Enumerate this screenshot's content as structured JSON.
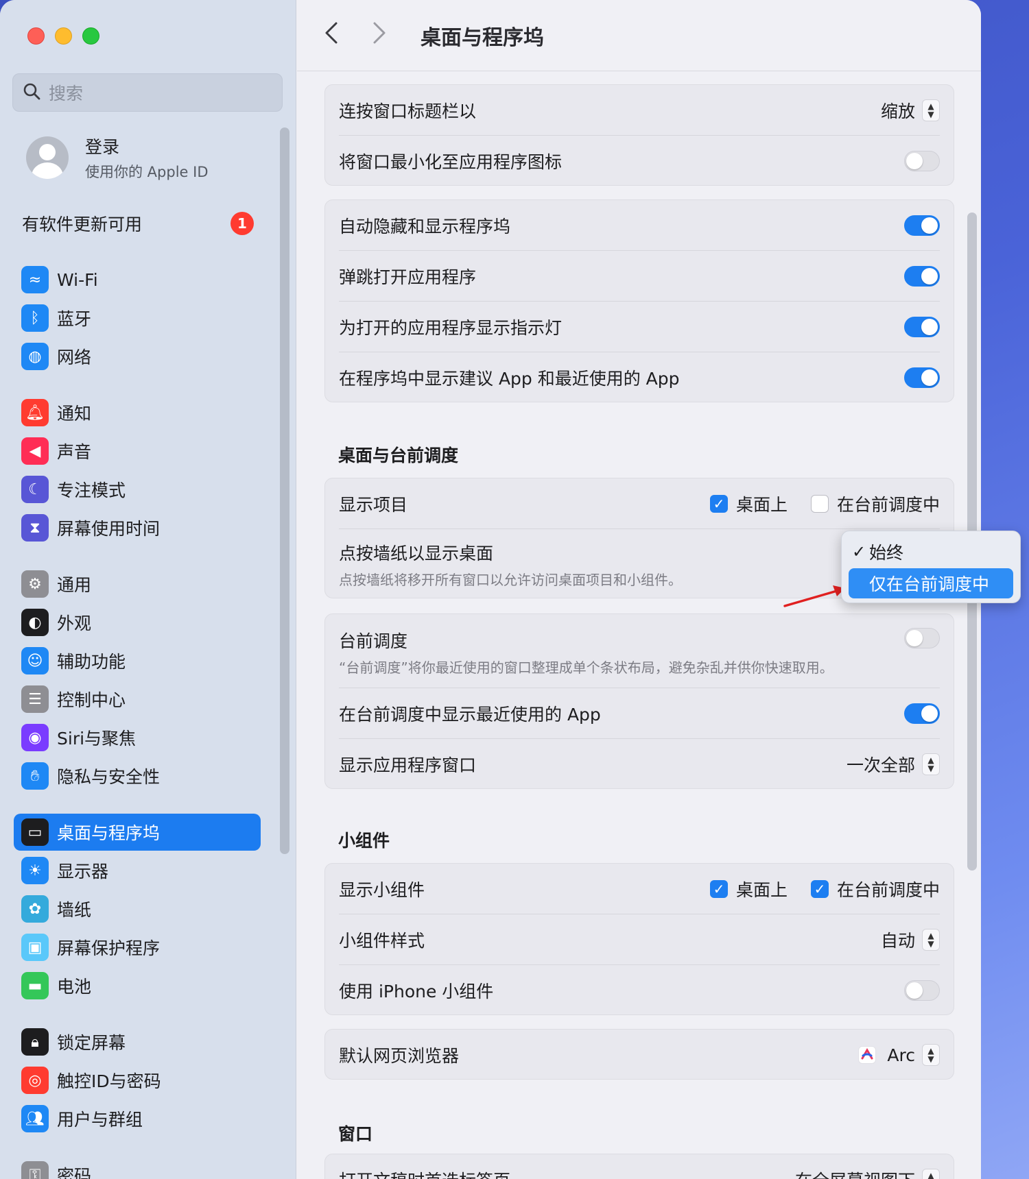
{
  "window": {
    "title": "桌面与程序坞"
  },
  "search": {
    "placeholder": "搜索"
  },
  "account": {
    "title": "登录",
    "subtitle": "使用你的 Apple ID"
  },
  "update": {
    "label": "有软件更新可用",
    "count": "1"
  },
  "sidebar": {
    "items": [
      {
        "label": "Wi-Fi",
        "icon": "wifi-icon",
        "color": "#1e88f5"
      },
      {
        "label": "蓝牙",
        "icon": "bluetooth-icon",
        "color": "#1e88f5"
      },
      {
        "label": "网络",
        "icon": "globe-icon",
        "color": "#1e88f5"
      },
      {
        "label": "通知",
        "icon": "bell-icon",
        "color": "#ff3b30"
      },
      {
        "label": "声音",
        "icon": "speaker-icon",
        "color": "#ff2d55"
      },
      {
        "label": "专注模式",
        "icon": "moon-icon",
        "color": "#5856d6"
      },
      {
        "label": "屏幕使用时间",
        "icon": "hourglass-icon",
        "color": "#5856d6"
      },
      {
        "label": "通用",
        "icon": "gear-icon",
        "color": "#8e8e93"
      },
      {
        "label": "外观",
        "icon": "appearance-icon",
        "color": "#1d1d1f"
      },
      {
        "label": "辅助功能",
        "icon": "accessibility-icon",
        "color": "#1e88f5"
      },
      {
        "label": "控制中心",
        "icon": "control-center-icon",
        "color": "#8e8e93"
      },
      {
        "label": "Siri与聚焦",
        "icon": "siri-icon",
        "color": "#7a3cff"
      },
      {
        "label": "隐私与安全性",
        "icon": "hand-icon",
        "color": "#1e88f5"
      },
      {
        "label": "桌面与程序坞",
        "icon": "dock-icon",
        "color": "#1d1d1f"
      },
      {
        "label": "显示器",
        "icon": "sun-icon",
        "color": "#1e88f5"
      },
      {
        "label": "墙纸",
        "icon": "flower-icon",
        "color": "#34aadc"
      },
      {
        "label": "屏幕保护程序",
        "icon": "screensaver-icon",
        "color": "#5ac8fa"
      },
      {
        "label": "电池",
        "icon": "battery-icon",
        "color": "#34c759"
      },
      {
        "label": "锁定屏幕",
        "icon": "lock-icon",
        "color": "#1d1d1f"
      },
      {
        "label": "触控ID与密码",
        "icon": "fingerprint-icon",
        "color": "#ff3b30"
      },
      {
        "label": "用户与群组",
        "icon": "users-icon",
        "color": "#1e88f5"
      },
      {
        "label": "密码",
        "icon": "key-icon",
        "color": "#8e8e93"
      }
    ]
  },
  "settings": {
    "double_click": {
      "label": "连按窗口标题栏以",
      "value": "缩放"
    },
    "minimize_to_icon": {
      "label": "将窗口最小化至应用程序图标"
    },
    "autohide": {
      "label": "自动隐藏和显示程序坞"
    },
    "bounce": {
      "label": "弹跳打开应用程序"
    },
    "indicators": {
      "label": "为打开的应用程序显示指示灯"
    },
    "suggested": {
      "label": "在程序坞中显示建议 App 和最近使用的 App"
    },
    "desktop_section": {
      "title": "桌面与台前调度"
    },
    "show_items": {
      "label": "显示项目",
      "opt1": "桌面上",
      "opt2": "在台前调度中"
    },
    "click_wallpaper": {
      "label": "点按墙纸以显示桌面",
      "sub": "点按墙纸将移开所有窗口以允许访问桌面项目和小组件。"
    },
    "stage_manager": {
      "label": "台前调度",
      "sub": "“台前调度”将你最近使用的窗口整理成单个条状布局，避免杂乱并供你快速取用。"
    },
    "recent_apps_sm": {
      "label": "在台前调度中显示最近使用的 App"
    },
    "show_windows": {
      "label": "显示应用程序窗口",
      "value": "一次全部"
    },
    "widgets_section": {
      "title": "小组件"
    },
    "show_widgets": {
      "label": "显示小组件",
      "opt1": "桌面上",
      "opt2": "在台前调度中"
    },
    "widget_style": {
      "label": "小组件样式",
      "value": "自动"
    },
    "iphone_widgets": {
      "label": "使用 iPhone 小组件"
    },
    "browser": {
      "label": "默认网页浏览器",
      "value": "Arc"
    },
    "window_section": {
      "title": "窗口"
    },
    "tabs_pref": {
      "label": "打开文稿时首选标签页",
      "value": "在全屏幕视图下"
    }
  },
  "popup": {
    "options": [
      "始终",
      "仅在台前调度中"
    ],
    "selected": "始终"
  },
  "toggles": {
    "minimize_to_icon": false,
    "autohide": true,
    "bounce": true,
    "indicators": true,
    "suggested": true,
    "stage_manager": false,
    "recent_apps_sm": true,
    "iphone_widgets": false
  },
  "checkboxes": {
    "show_items_desktop": true,
    "show_items_sm": false,
    "widgets_desktop": true,
    "widgets_sm": true
  },
  "colors": {
    "accent": "#1d7ef1",
    "badge": "#ff3b30",
    "annotation_arrow": "#e02020"
  }
}
